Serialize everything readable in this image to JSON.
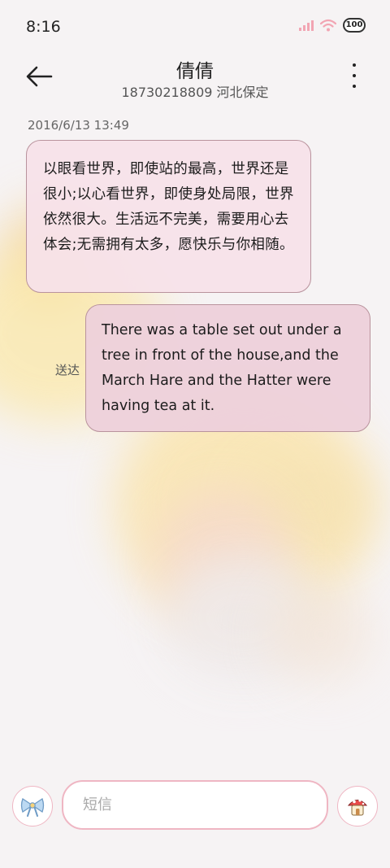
{
  "status_bar": {
    "time": "8:16",
    "battery": "100",
    "icons": [
      "signal-icon",
      "wifi-icon",
      "battery-icon"
    ]
  },
  "header": {
    "contact_name": "倩倩",
    "contact_subtitle": "18730218809 河北保定",
    "icons": [
      "back-arrow-icon",
      "more-vertical-icon"
    ]
  },
  "conversation": {
    "timestamp": "2016/6/13 13:49",
    "messages": [
      {
        "direction": "incoming",
        "text": "以眼看世界，即使站的最高，世界还是很小;以心看世界，即使身处局限，世界依然很大。生活远不完美，需要用心去体会;无需拥有太多，愿快乐与你相随。"
      },
      {
        "direction": "outgoing",
        "text": "There was a table set out under a tree in front of the house,and the March Hare and the Hatter were having tea at it.",
        "status": "送达"
      }
    ]
  },
  "composer": {
    "placeholder": "短信",
    "value": "",
    "icons": [
      "bow-emoji-icon",
      "mushroom-house-send-icon"
    ]
  },
  "colors": {
    "bubble_border": "#b9939d",
    "incoming_bubble": "#f7e2e9",
    "outgoing_bubble": "#edd0db",
    "accent_pink": "#efb6c3"
  }
}
